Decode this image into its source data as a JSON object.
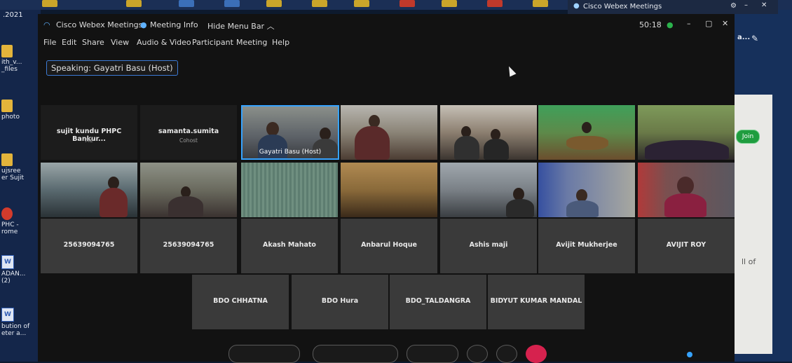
{
  "desktop": {
    "date_fragment": ".2021",
    "icons": [
      {
        "label": "ith_v...\n_files",
        "icon": "folder-icon"
      },
      {
        "label": "photo",
        "icon": "folder-icon"
      },
      {
        "label": "ujsree\ner Sujit",
        "icon": "folder-icon"
      },
      {
        "label": "PHC -\nrome",
        "icon": "chrome-icon"
      },
      {
        "label": "ADAN...\n(2)",
        "icon": "word-doc-icon"
      },
      {
        "label": "bution of\neter a...",
        "icon": "word-doc-icon"
      }
    ],
    "right_fragments": {
      "top": "a...",
      "join": "Join",
      "text": "ll of"
    }
  },
  "outer_titlebar": {
    "title": "Cisco Webex Meetings"
  },
  "window": {
    "app_name": "Cisco Webex Meetings",
    "meeting_info": "Meeting Info",
    "hide_menu": "Hide Menu Bar",
    "timer": "50:18",
    "menu": [
      "File",
      "Edit",
      "Share",
      "View",
      "Audio & Video",
      "Participant",
      "Meeting",
      "Help"
    ],
    "speaking": "Speaking: Gayatri Basu (Host)"
  },
  "participants_row1": [
    {
      "name": "sujit kundu PHPC Bankur...",
      "sub": "Me",
      "type": "name"
    },
    {
      "name": "samanta.sumita",
      "sub": "Cohost",
      "type": "name"
    },
    {
      "name": "Gayatri Basu  (Host)",
      "type": "video",
      "active": true
    }
  ],
  "participants_row3": [
    "25639094765",
    "25639094765",
    "Akash Mahato",
    "Anbarul Hoque",
    "Ashis maji",
    "Avijit Mukherjee",
    "AVIJIT ROY"
  ],
  "participants_row4": [
    "BDO CHHATNA",
    "BDO Hura",
    "BDO_TALDANGRA",
    "BIDYUT KUMAR MANDAL"
  ],
  "colors": {
    "accent": "#36a3ff",
    "end_button": "#d6224e",
    "status_green": "#2bb24c"
  }
}
